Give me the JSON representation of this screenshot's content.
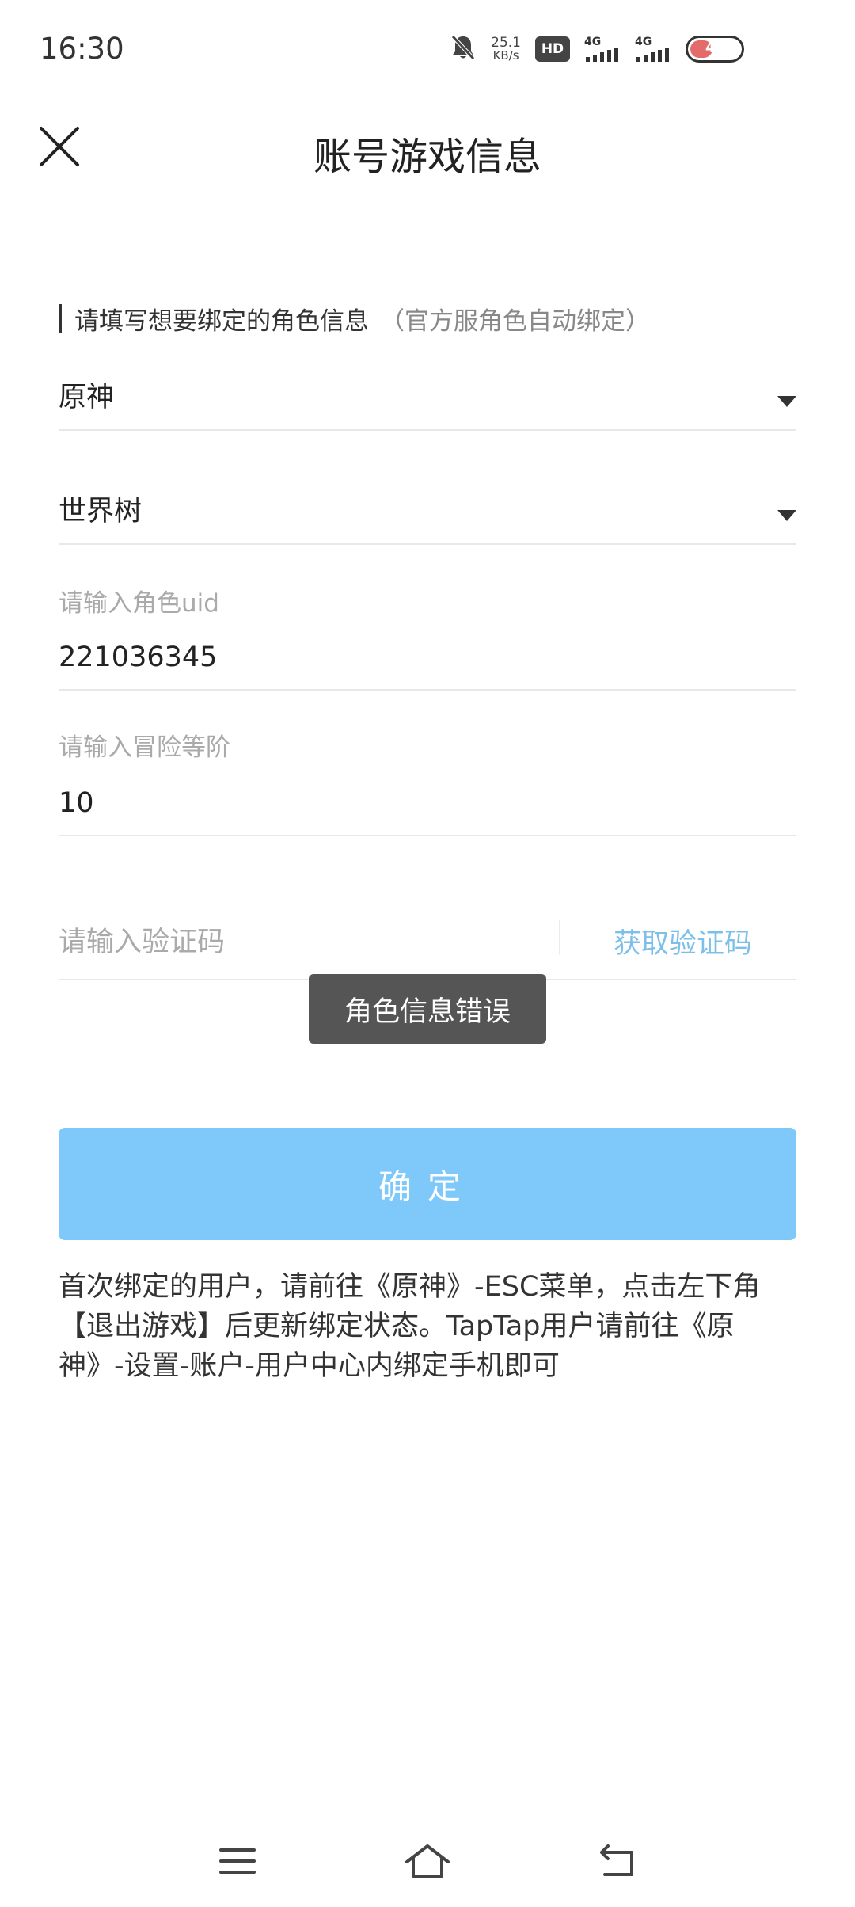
{
  "status_bar": {
    "time": "16:30",
    "net_speed_value": "25.1",
    "net_speed_unit": "KB/s",
    "hd_badge": "HD",
    "signal1_label": "4G",
    "signal2_label": "4G",
    "battery_level": "4",
    "icons": [
      "bell-off-icon",
      "hd-icon",
      "signal-icon",
      "signal-icon",
      "battery-icon"
    ]
  },
  "header": {
    "title": "账号游戏信息"
  },
  "section": {
    "label": "请填写想要绑定的角色信息",
    "hint": "（官方服角色自动绑定）"
  },
  "game_select": {
    "value": "原神"
  },
  "server_select": {
    "value": "世界树"
  },
  "uid_input": {
    "label": "请输入角色uid",
    "value": "221036345"
  },
  "level_input": {
    "label": "请输入冒险等阶",
    "value": "10"
  },
  "code_input": {
    "placeholder": "请输入验证码",
    "get_code_label": "获取验证码"
  },
  "toast": {
    "message": "角色信息错误"
  },
  "confirm_button": {
    "label": "确定"
  },
  "notice": {
    "text": "首次绑定的用户，请前往《原神》-ESC菜单，点击左下角【退出游戏】后更新绑定状态。TapTap用户请前往《原神》-设置-账户-用户中心内绑定手机即可"
  },
  "colors": {
    "accent": "#7fc8fa",
    "link": "#7cc0ea",
    "toast_bg": "#555555"
  }
}
